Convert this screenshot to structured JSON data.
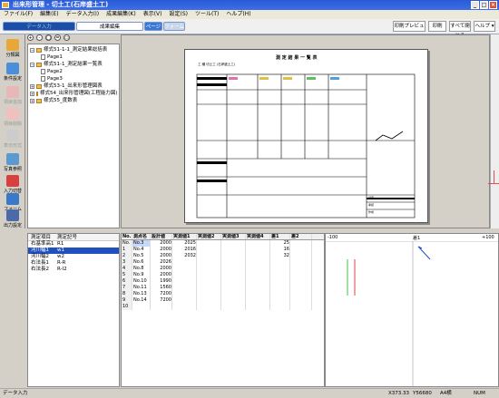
{
  "window": {
    "title": "出来形管理 - 切土工(石岸盛土工)"
  },
  "menu": [
    "ファイル(F)",
    "編集(E)",
    "データ入力(I)",
    "成果編集(K)",
    "表示(V)",
    "設定(S)",
    "ツール(T)",
    "ヘルプ(H)"
  ],
  "ribbon": {
    "tabs": [
      "データ入力",
      "成果編集",
      "ページ",
      "フォーム"
    ],
    "buttons": [
      "印刷プレビュー",
      "印刷",
      "すべて閉じる",
      "ヘルプ ▾"
    ]
  },
  "sidebar": [
    "分類図",
    "条件設定",
    "項目追加",
    "項目削除",
    "表示形式",
    "写真参照",
    "入力切替",
    "フォーム",
    "出力設定"
  ],
  "tree": [
    "様式51-1-1_測定結果総括表",
    "Page1",
    "様式51-1_測定結果一覧表",
    "Page2",
    "Page3",
    "様式53-1_出来形管理図表",
    "様式54_出来形管理図(工程能力図)",
    "様式55_度数表"
  ],
  "preview": {
    "sheet_title": "測 定 結 果 一 覧 表",
    "sheet_subtitle": "工 種 切土工 (石岸盛土工)",
    "footer_labels": [
      "記事",
      "承認",
      "作成"
    ]
  },
  "measure_list": {
    "headers": [
      "測定項目",
      "測定記号"
    ],
    "rows": [
      [
        "右基準高1",
        "R1"
      ],
      [
        "河川幅1",
        "w1"
      ],
      [
        "河川幅2",
        "w2"
      ],
      [
        "右法長1",
        "R-R"
      ],
      [
        "右法長2",
        "R-l2"
      ]
    ],
    "selected": 1
  },
  "grid": {
    "headers": [
      "No.",
      "測点名",
      "設計値",
      "実測値1",
      "実測値2",
      "実測値3",
      "実測値4",
      "差1",
      "差2"
    ],
    "rows": [
      [
        "No.",
        "No.3",
        "2000",
        "2025",
        "",
        "",
        "",
        "25",
        ""
      ],
      [
        "1",
        "No.4",
        "2000",
        "2016",
        "",
        "",
        "",
        "16",
        ""
      ],
      [
        "2",
        "No.5",
        "2000",
        "2032",
        "",
        "",
        "",
        "32",
        ""
      ],
      [
        "3",
        "No.6",
        "2026",
        "",
        "",
        "",
        "",
        "",
        ""
      ],
      [
        "4",
        "No.8",
        "2000",
        "",
        "",
        "",
        "",
        "",
        ""
      ],
      [
        "5",
        "No.9",
        "2000",
        "",
        "",
        "",
        "",
        "",
        ""
      ],
      [
        "6",
        "No.10",
        "1990",
        "",
        "",
        "",
        "",
        "",
        ""
      ],
      [
        "7",
        "No.11",
        "1560",
        "",
        "",
        "",
        "",
        "",
        ""
      ],
      [
        "8",
        "No.13",
        "7200",
        "",
        "",
        "",
        "",
        "",
        ""
      ],
      [
        "9",
        "No.14",
        "7200",
        "",
        "",
        "",
        "",
        "",
        ""
      ],
      [
        "10",
        "",
        "",
        "",
        "",
        "",
        "",
        "",
        ""
      ]
    ]
  },
  "graph": {
    "left_label": "-100",
    "mid_label": "差1",
    "right_label": "+100"
  },
  "status": {
    "left": "データ入力",
    "x": "X373.33",
    "y": "Y56680",
    "zoom": "A4横",
    "num": "NUM"
  },
  "colors": {
    "accent": "#2a5bd7",
    "selection": "#2050c0"
  }
}
